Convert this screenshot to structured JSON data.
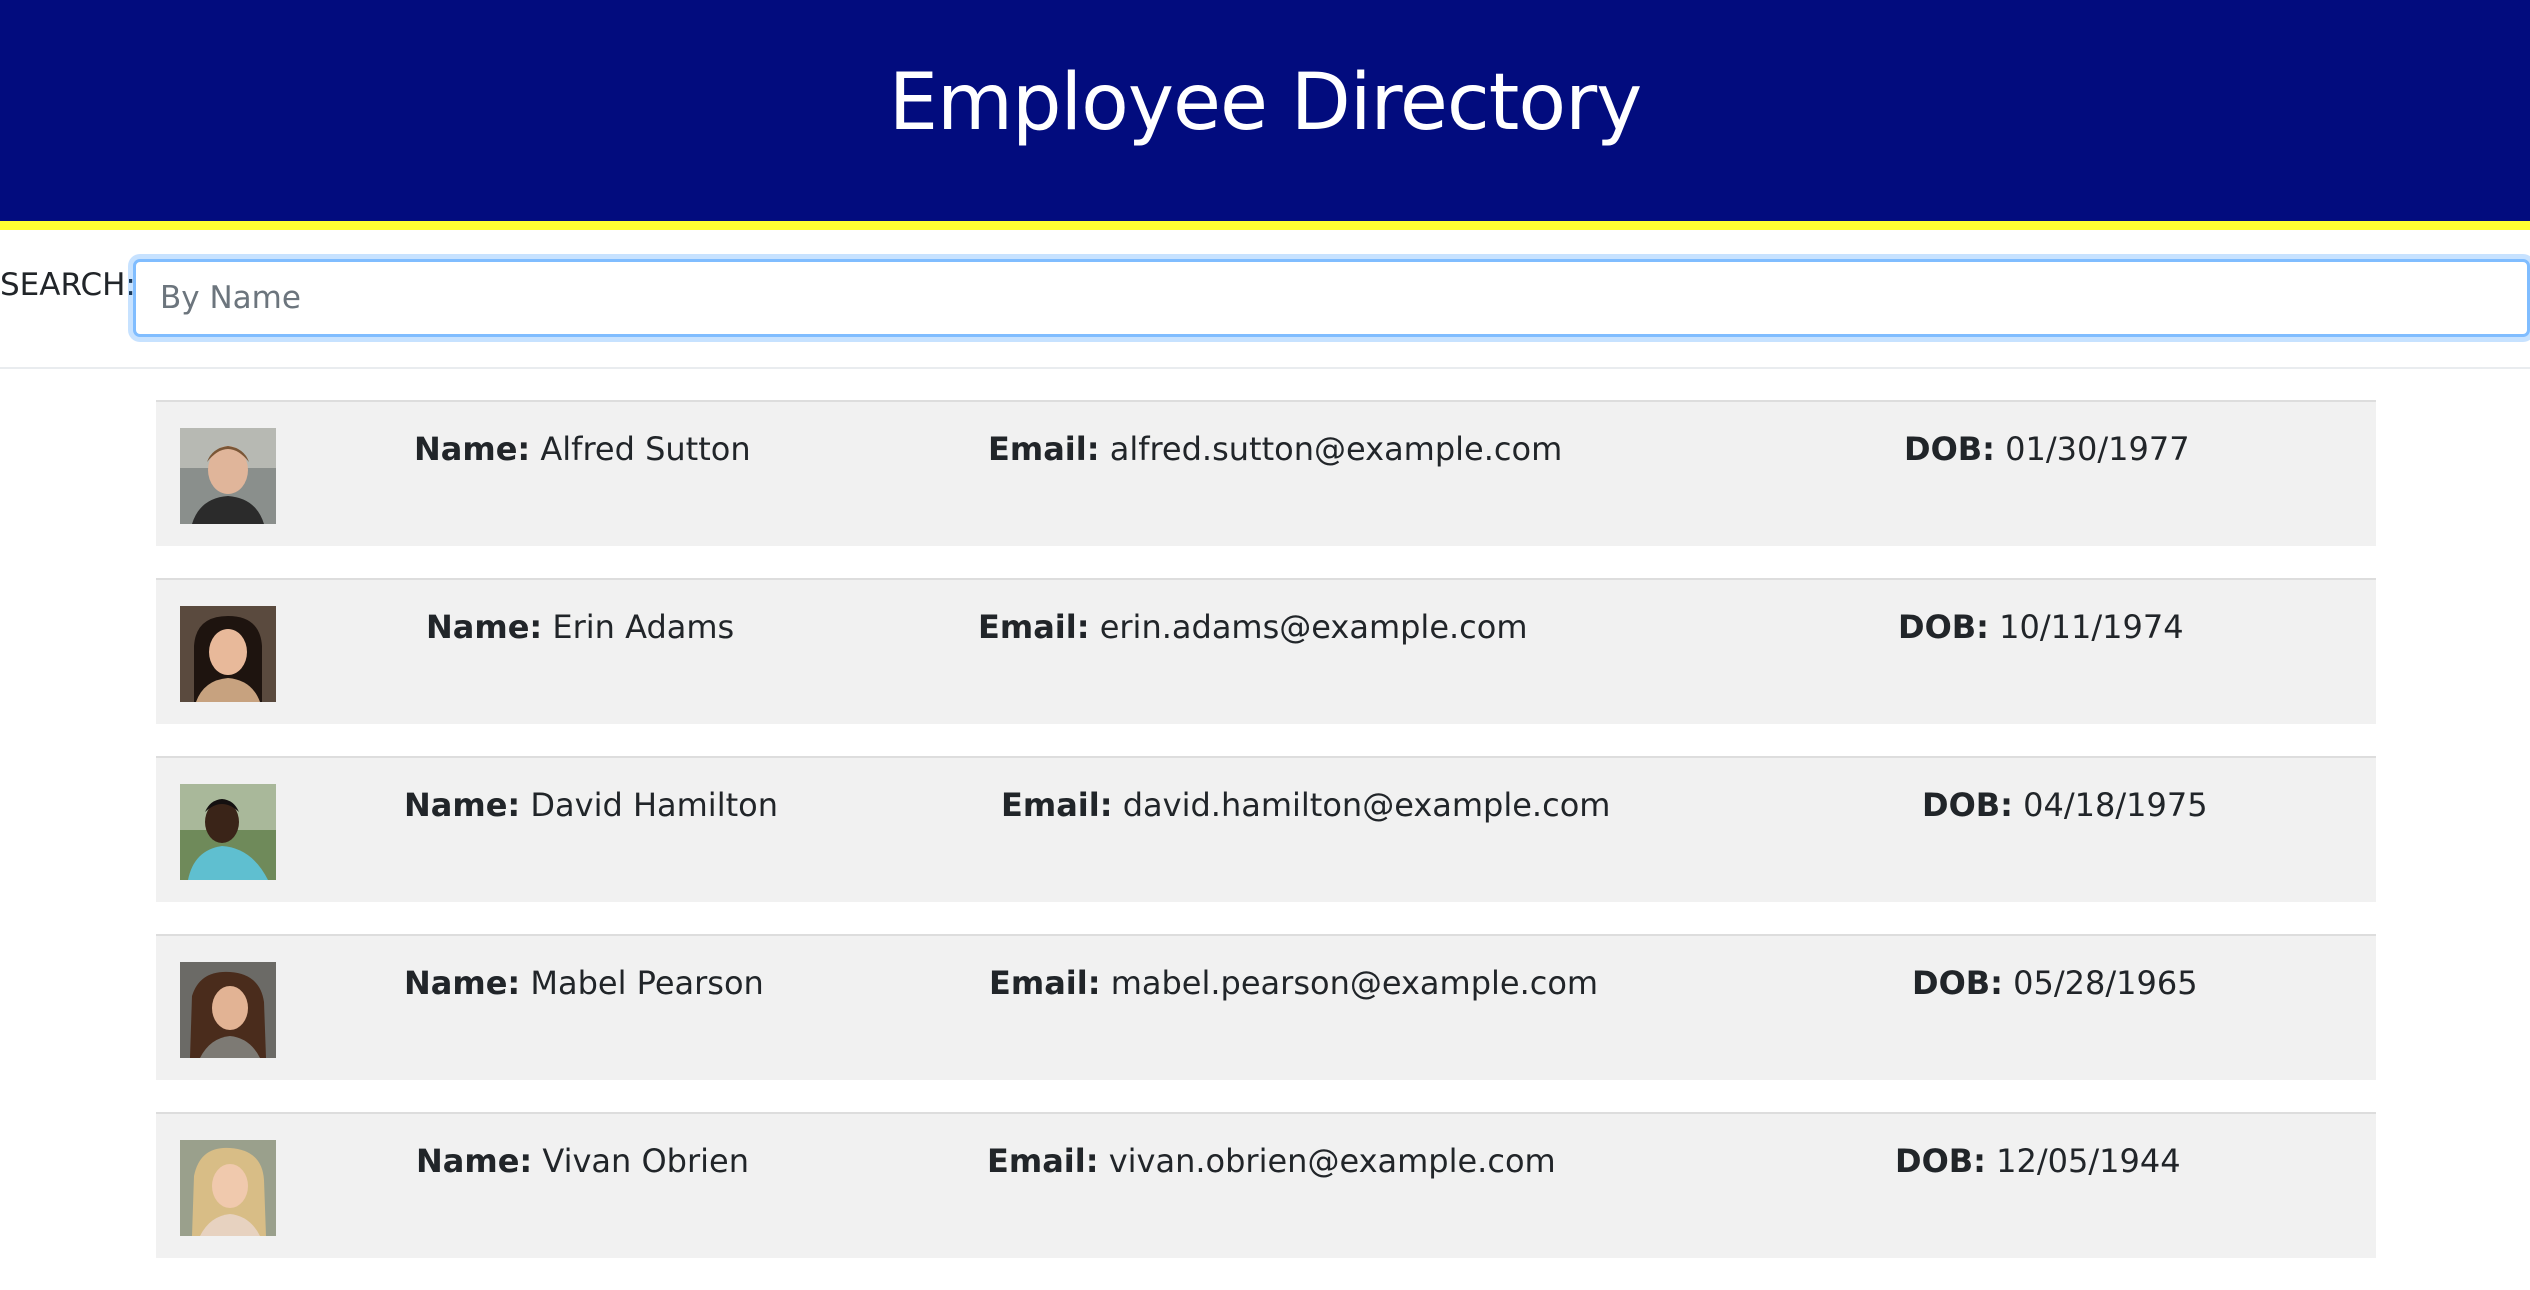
{
  "header": {
    "title": "Employee Directory"
  },
  "search": {
    "label": "SEARCH:",
    "placeholder": "By Name",
    "value": ""
  },
  "labels": {
    "name": "Name:",
    "email": "Email:",
    "dob": "DOB:"
  },
  "colors": {
    "header_bg": "#020c7e",
    "header_stripe": "#ffff33",
    "card_bg": "#f1f1f1"
  },
  "employees": [
    {
      "name": "Alfred Sutton",
      "email": "alfred.sutton@example.com",
      "dob": "01/30/1977",
      "avatar": "person-photo"
    },
    {
      "name": "Erin Adams",
      "email": "erin.adams@example.com",
      "dob": "10/11/1974",
      "avatar": "person-photo"
    },
    {
      "name": "David Hamilton",
      "email": "david.hamilton@example.com",
      "dob": "04/18/1975",
      "avatar": "person-photo"
    },
    {
      "name": "Mabel Pearson",
      "email": "mabel.pearson@example.com",
      "dob": "05/28/1965",
      "avatar": "person-photo"
    },
    {
      "name": "Vivan Obrien",
      "email": "vivan.obrien@example.com",
      "dob": "12/05/1944",
      "avatar": "person-photo"
    }
  ]
}
